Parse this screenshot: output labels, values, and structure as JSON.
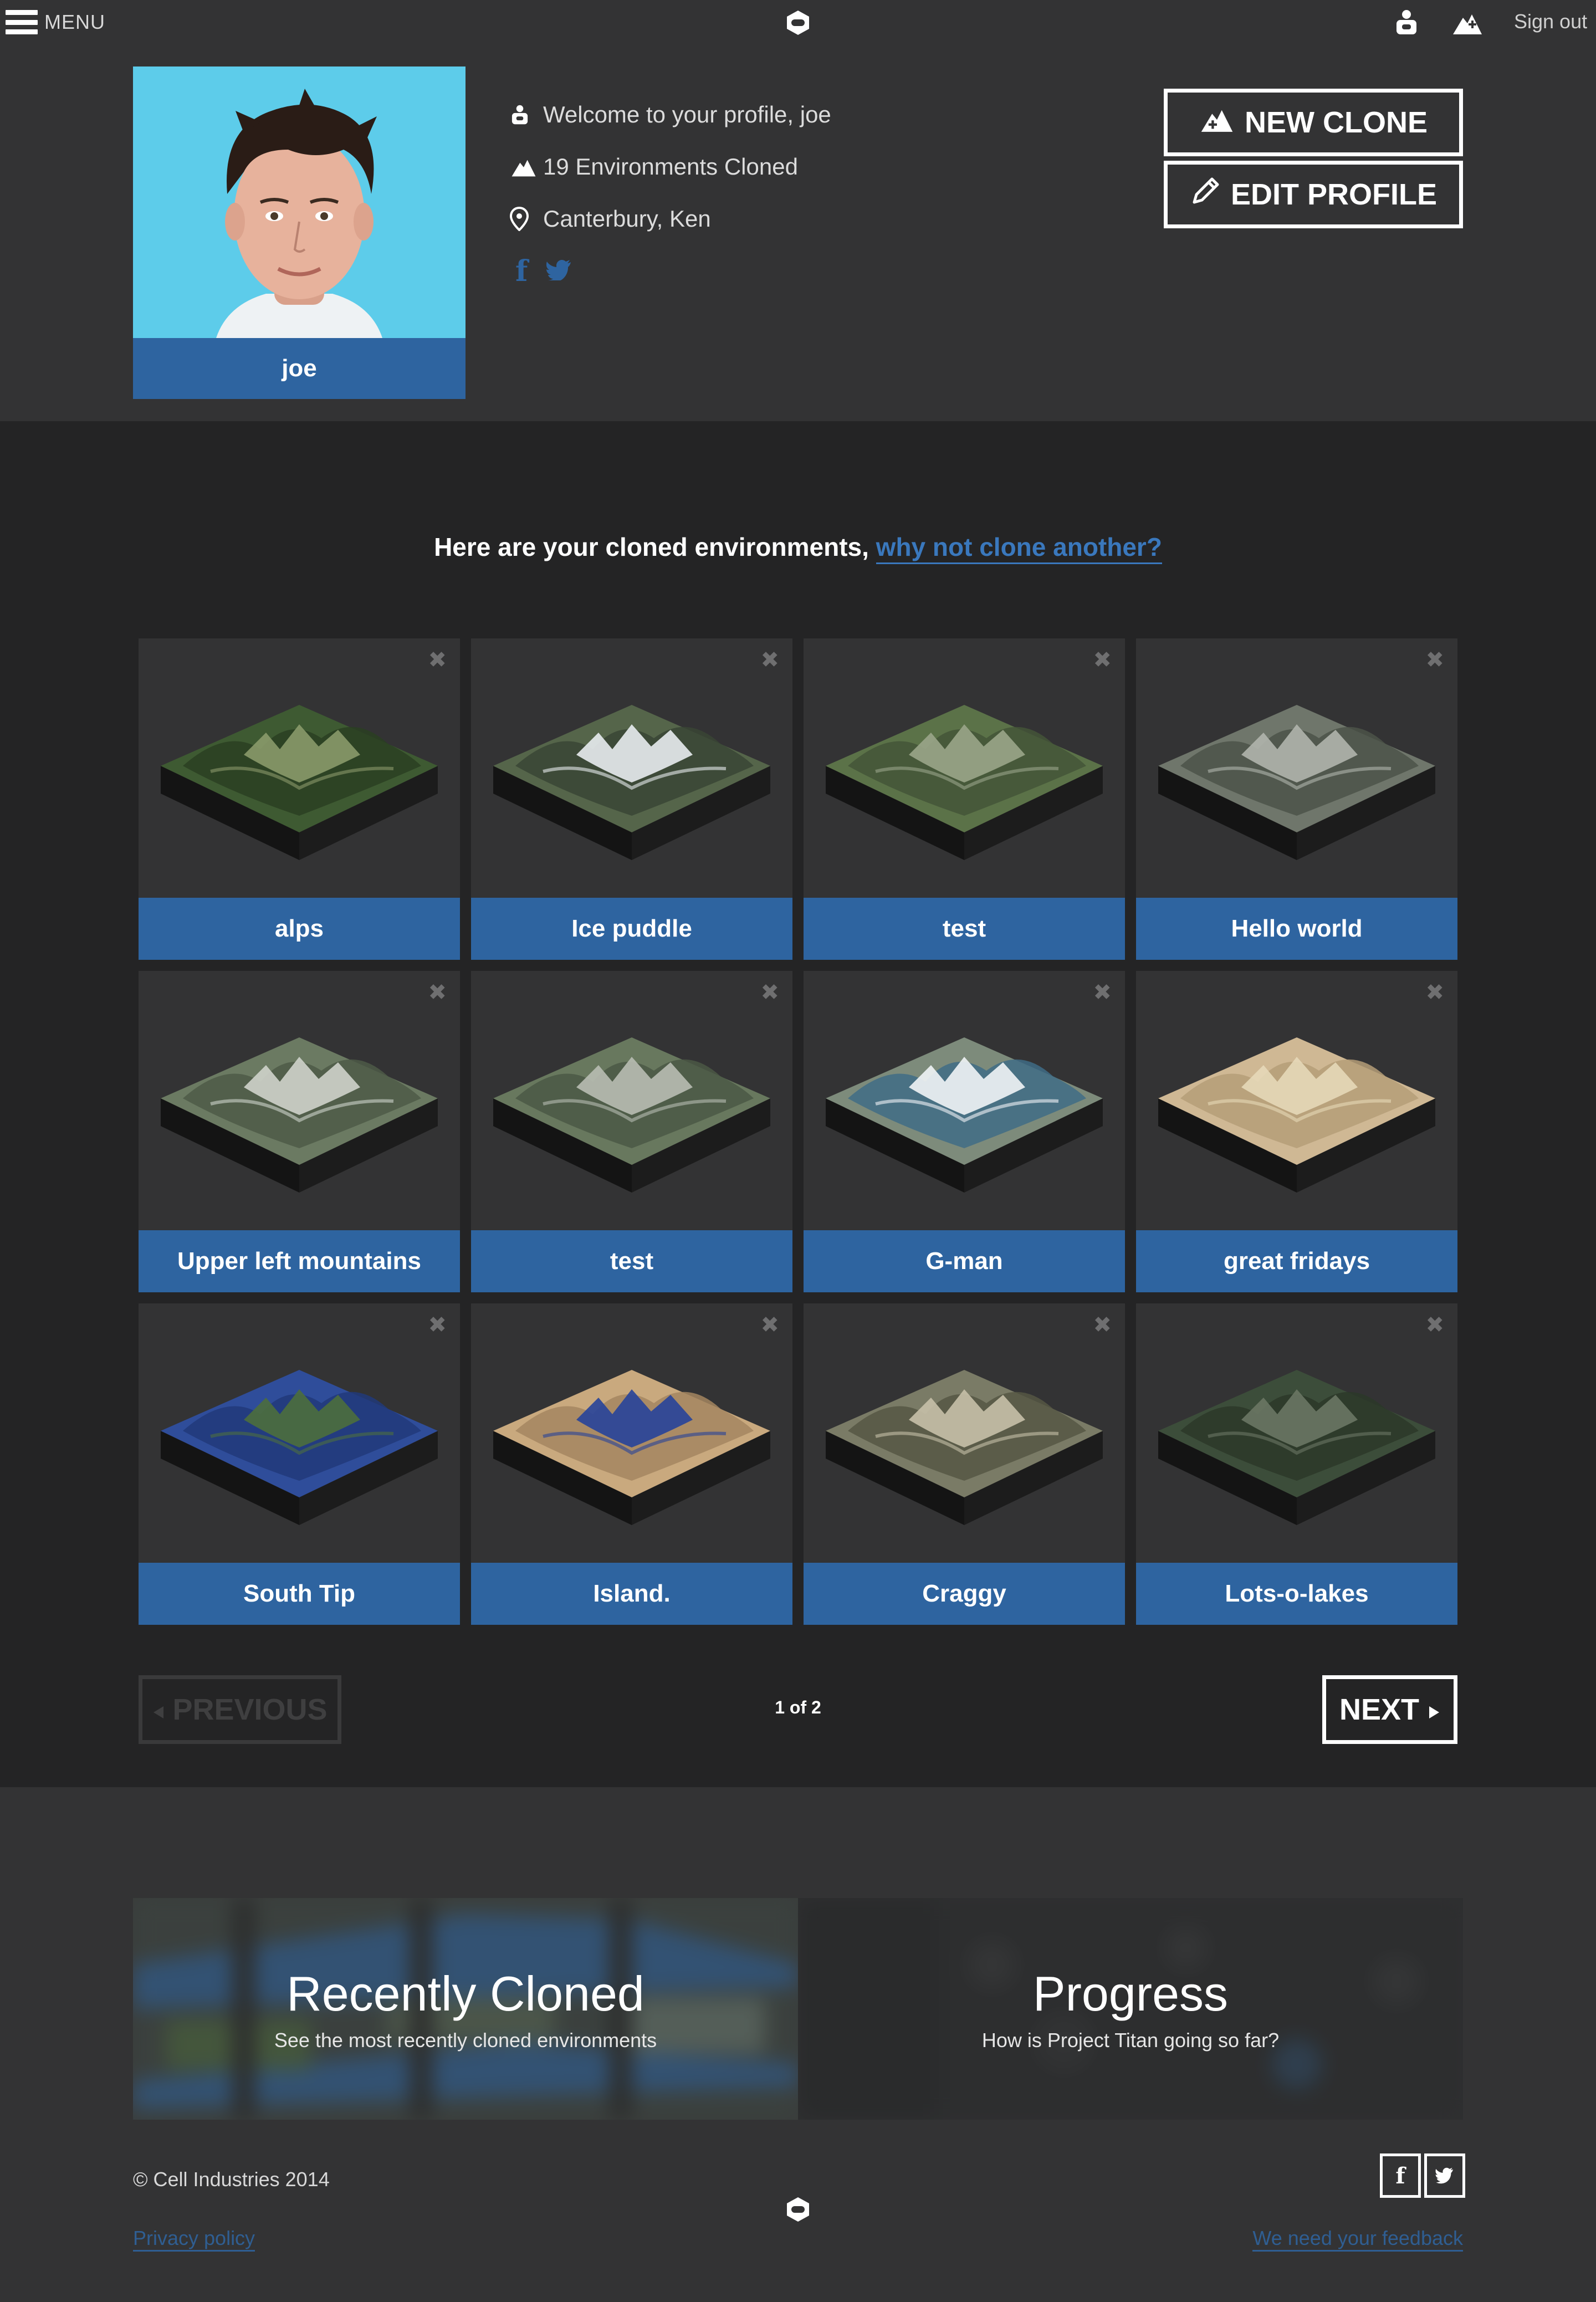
{
  "topbar": {
    "menu_label": "MENU",
    "sign_out": "Sign out",
    "icons": [
      "hamburger-icon",
      "cell-logo-icon",
      "user-icon",
      "new-clone-mountain-icon"
    ]
  },
  "profile": {
    "username": "joe",
    "welcome": "Welcome to your profile, joe",
    "environments_cloned": "19 Environments Cloned",
    "location": "Canterbury, Ken",
    "social": [
      "facebook-icon",
      "twitter-icon"
    ],
    "new_clone_label": "NEW CLONE",
    "edit_profile_label": "EDIT PROFILE"
  },
  "environments": {
    "intro": "Here are your cloned environments,",
    "intro_link": "why not clone another?",
    "close_glyph": "✖",
    "cards": [
      {
        "name": "alps",
        "terrain": "green-mountains"
      },
      {
        "name": "Ice puddle",
        "terrain": "snowy-peaks"
      },
      {
        "name": "test",
        "terrain": "green-hills"
      },
      {
        "name": "Hello world",
        "terrain": "grey-mountains"
      },
      {
        "name": "Upper left mountains",
        "terrain": "rocky-mountains"
      },
      {
        "name": "test",
        "terrain": "grey-green-hills"
      },
      {
        "name": "G-man",
        "terrain": "snow-lake"
      },
      {
        "name": "great fridays",
        "terrain": "desert-flat"
      },
      {
        "name": "South Tip",
        "terrain": "island-ocean"
      },
      {
        "name": "Island.",
        "terrain": "coast-desert"
      },
      {
        "name": "Craggy",
        "terrain": "craggy-mountains"
      },
      {
        "name": "Lots-o-lakes",
        "terrain": "lakes-forest"
      }
    ],
    "pager": {
      "previous": "PREVIOUS",
      "count": "1 of 2",
      "next": "NEXT"
    }
  },
  "promo": {
    "recent_title": "Recently Cloned",
    "recent_sub": "See the most recently cloned environments",
    "progress_title": "Progress",
    "progress_sub": "How is Project Titan going so far?"
  },
  "footer": {
    "copyright": "© Cell Industries 2014",
    "privacy": "Privacy policy",
    "feedback": "We need your feedback",
    "social": [
      "facebook-icon",
      "twitter-icon"
    ]
  },
  "colors": {
    "accent_blue": "#2e64a0",
    "link_blue": "#3a78bd",
    "bg_dark": "#242425",
    "bg_panel": "#333334",
    "avatar_bg": "#5dccea"
  }
}
